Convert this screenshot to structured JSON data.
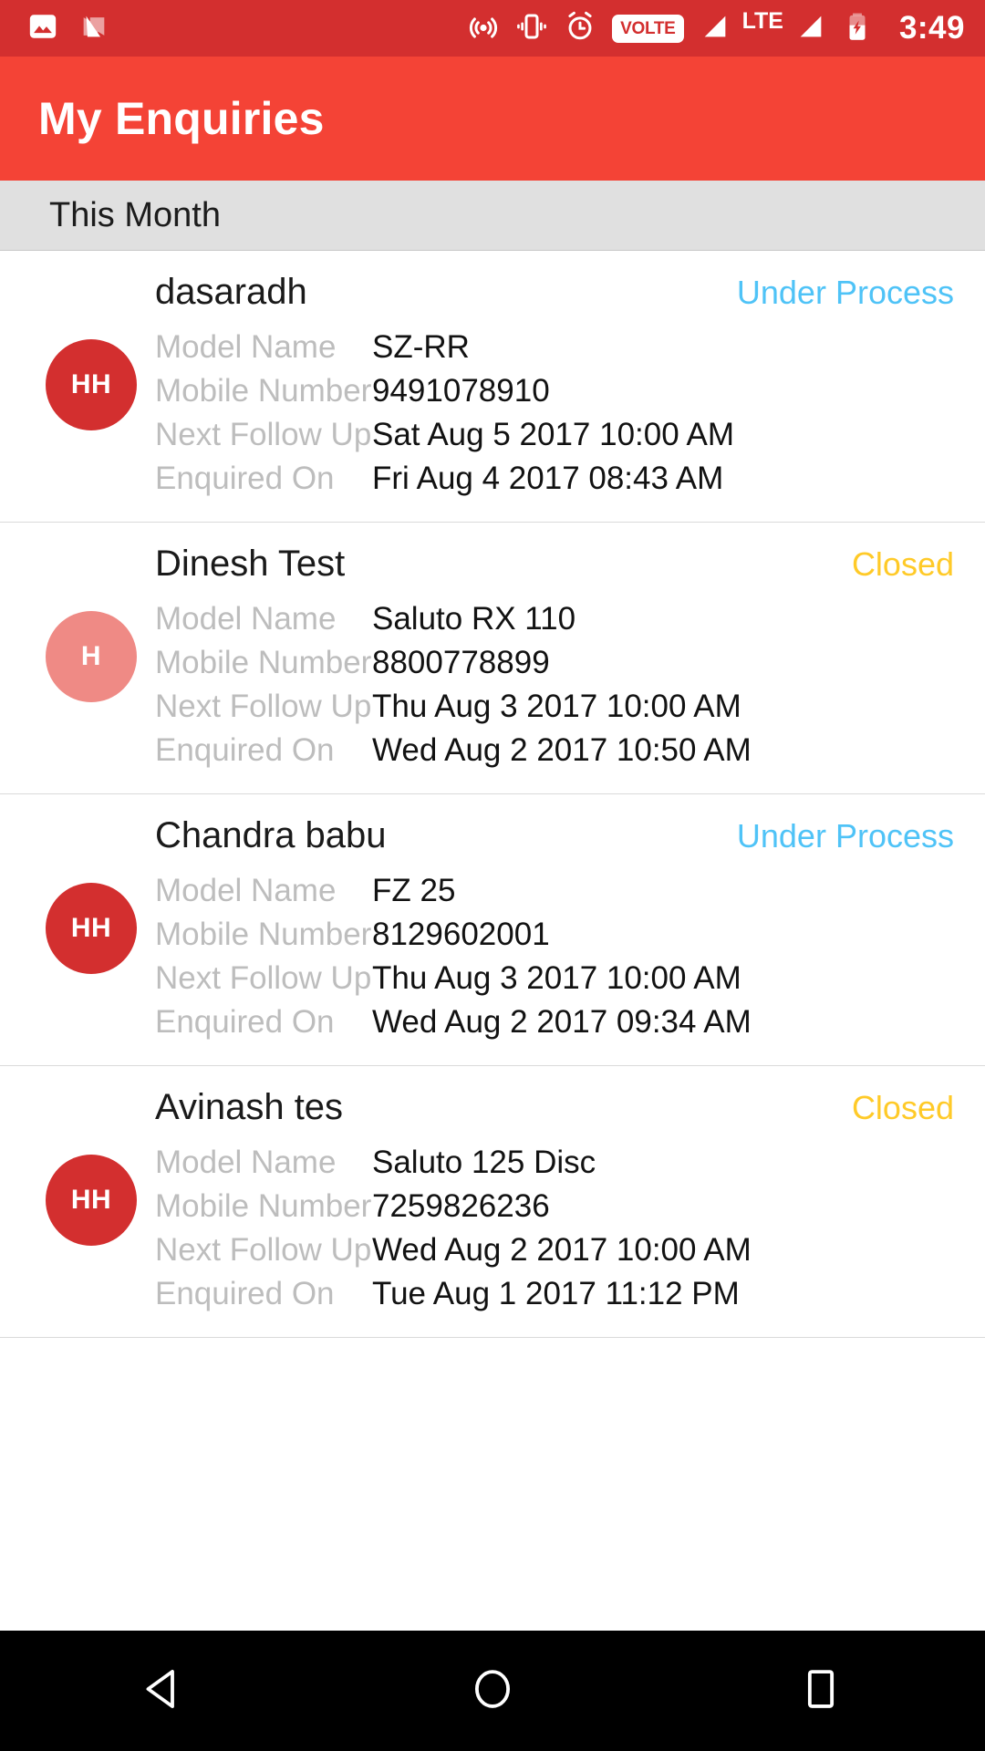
{
  "statusbar": {
    "time": "3:49",
    "volte_label": "VOLTE",
    "lte_label": "LTE",
    "left_icons": [
      "photo-icon",
      "android-nougat-icon"
    ],
    "right_icons": [
      "hotspot-icon",
      "vibrate-icon",
      "alarm-icon",
      "volte-badge",
      "signal-icon",
      "lte-label",
      "signal-icon-2",
      "battery-charging-icon"
    ],
    "colors": {
      "background": "#d32f2f",
      "foreground": "#ffffff"
    }
  },
  "appbar": {
    "title": "My Enquiries",
    "color": "#f44336"
  },
  "section": {
    "label": "This Month"
  },
  "labels": {
    "model_name": "Model Name",
    "mobile_number": "Mobile Number",
    "next_follow_up": "Next Follow Up",
    "enquired_on": "Enquired On"
  },
  "status_colors": {
    "under_process": "#4fc3f7",
    "closed": "#ffca28"
  },
  "enquiries": [
    {
      "name": "dasaradh",
      "status": "Under Process",
      "status_kind": "under-process",
      "avatar_initials": "HH",
      "avatar_color": "#d32f2f",
      "model_name": "SZ-RR",
      "mobile_number": "9491078910",
      "next_follow_up": "Sat Aug 5 2017 10:00 AM",
      "enquired_on": "Fri Aug 4 2017 08:43 AM"
    },
    {
      "name": "Dinesh Test",
      "status": "Closed",
      "status_kind": "closed",
      "avatar_initials": "H",
      "avatar_color": "#ef8a85",
      "model_name": "Saluto RX 110",
      "mobile_number": "8800778899",
      "next_follow_up": "Thu Aug 3 2017 10:00 AM",
      "enquired_on": "Wed Aug 2 2017 10:50 AM"
    },
    {
      "name": "Chandra babu",
      "status": "Under Process",
      "status_kind": "under-process",
      "avatar_initials": "HH",
      "avatar_color": "#d32f2f",
      "model_name": "FZ 25",
      "mobile_number": "8129602001",
      "next_follow_up": "Thu Aug 3 2017 10:00 AM",
      "enquired_on": "Wed Aug 2 2017 09:34 AM"
    },
    {
      "name": "Avinash tes",
      "status": "Closed",
      "status_kind": "closed",
      "avatar_initials": "HH",
      "avatar_color": "#d32f2f",
      "model_name": "Saluto 125 Disc",
      "mobile_number": "7259826236",
      "next_follow_up": "Wed Aug 2 2017 10:00 AM",
      "enquired_on": "Tue Aug 1 2017 11:12 PM"
    }
  ],
  "navbar": {
    "back_label": "Back",
    "home_label": "Home",
    "recents_label": "Recent apps"
  }
}
